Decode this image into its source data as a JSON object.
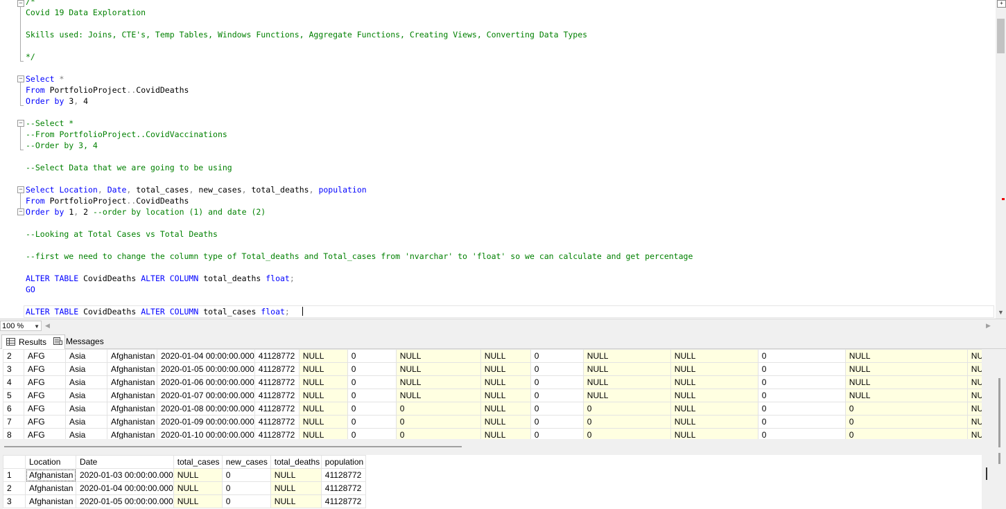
{
  "editor": {
    "lines": [
      {
        "parts": [
          {
            "t": "/*",
            "c": "cm"
          }
        ]
      },
      {
        "parts": [
          {
            "t": "Covid 19 Data Exploration",
            "c": "cm"
          }
        ]
      },
      {
        "parts": []
      },
      {
        "parts": [
          {
            "t": "Skills used: Joins, CTE's, Temp Tables, Windows Functions, Aggregate Functions, Creating Views, Converting Data Types",
            "c": "cm"
          }
        ]
      },
      {
        "parts": []
      },
      {
        "parts": [
          {
            "t": "*/",
            "c": "cm"
          }
        ]
      },
      {
        "parts": []
      },
      {
        "parts": [
          {
            "t": "Select",
            "c": "kw"
          },
          {
            "t": " *",
            "c": "gr"
          }
        ]
      },
      {
        "parts": [
          {
            "t": "From",
            "c": "kw"
          },
          {
            "t": " PortfolioProject",
            "c": ""
          },
          {
            "t": "..",
            "c": "gr"
          },
          {
            "t": "CovidDeaths",
            "c": ""
          }
        ]
      },
      {
        "parts": [
          {
            "t": "Order by",
            "c": "kw"
          },
          {
            "t": " 3",
            "c": ""
          },
          {
            "t": ",",
            "c": "gr"
          },
          {
            "t": " 4",
            "c": ""
          }
        ]
      },
      {
        "parts": []
      },
      {
        "parts": [
          {
            "t": "--Select *",
            "c": "cm"
          }
        ]
      },
      {
        "parts": [
          {
            "t": "--From PortfolioProject..CovidVaccinations",
            "c": "cm"
          }
        ]
      },
      {
        "parts": [
          {
            "t": "--Order by 3, 4",
            "c": "cm"
          }
        ]
      },
      {
        "parts": []
      },
      {
        "parts": [
          {
            "t": "--Select Data that we are going to be using",
            "c": "cm"
          }
        ]
      },
      {
        "parts": []
      },
      {
        "parts": [
          {
            "t": "Select",
            "c": "kw"
          },
          {
            "t": " Location",
            "c": "kw"
          },
          {
            "t": ",",
            "c": "gr"
          },
          {
            "t": " Date",
            "c": "kw"
          },
          {
            "t": ",",
            "c": "gr"
          },
          {
            "t": " total_cases",
            "c": ""
          },
          {
            "t": ",",
            "c": "gr"
          },
          {
            "t": " new_cases",
            "c": ""
          },
          {
            "t": ",",
            "c": "gr"
          },
          {
            "t": " total_deaths",
            "c": ""
          },
          {
            "t": ",",
            "c": "gr"
          },
          {
            "t": " population",
            "c": "kw"
          }
        ]
      },
      {
        "parts": [
          {
            "t": "From",
            "c": "kw"
          },
          {
            "t": " PortfolioProject",
            "c": ""
          },
          {
            "t": "..",
            "c": "gr"
          },
          {
            "t": "CovidDeaths",
            "c": ""
          }
        ]
      },
      {
        "parts": [
          {
            "t": "Order by",
            "c": "kw"
          },
          {
            "t": " 1",
            "c": ""
          },
          {
            "t": ",",
            "c": "gr"
          },
          {
            "t": " 2",
            "c": ""
          },
          {
            "t": " --order by location (1) and date (2)",
            "c": "cm"
          }
        ]
      },
      {
        "parts": []
      },
      {
        "parts": [
          {
            "t": "--Looking at Total Cases vs Total Deaths",
            "c": "cm"
          }
        ]
      },
      {
        "parts": []
      },
      {
        "parts": [
          {
            "t": "--first we need to change the column type of Total_deaths and Total_cases from 'nvarchar' to 'float' so we can calculate and get percentage",
            "c": "cm"
          }
        ]
      },
      {
        "parts": []
      },
      {
        "parts": [
          {
            "t": "ALTER TABLE",
            "c": "kw"
          },
          {
            "t": " CovidDeaths ",
            "c": ""
          },
          {
            "t": "ALTER COLUMN",
            "c": "kw"
          },
          {
            "t": " total_deaths ",
            "c": ""
          },
          {
            "t": "float",
            "c": "kw"
          },
          {
            "t": ";",
            "c": "gr"
          }
        ]
      },
      {
        "parts": [
          {
            "t": "GO",
            "c": "kw"
          }
        ]
      },
      {
        "parts": []
      },
      {
        "parts": [
          {
            "t": "ALTER TABLE",
            "c": "kw"
          },
          {
            "t": " CovidDeaths ",
            "c": ""
          },
          {
            "t": "ALTER COLUMN",
            "c": "kw"
          },
          {
            "t": " total_cases ",
            "c": ""
          },
          {
            "t": "float",
            "c": "kw"
          },
          {
            "t": ";",
            "c": "gr"
          }
        ]
      }
    ]
  },
  "zoom": {
    "value": "100 %"
  },
  "tabs": {
    "results": "Results",
    "messages": "Messages"
  },
  "grid1": {
    "rows": [
      [
        "2",
        "AFG",
        "Asia",
        "Afghanistan",
        "2020-01-04 00:00:00.000",
        "41128772",
        "NULL",
        "0",
        "NULL",
        "NULL",
        "0",
        "NULL",
        "NULL",
        "0",
        "NULL",
        "NU"
      ],
      [
        "3",
        "AFG",
        "Asia",
        "Afghanistan",
        "2020-01-05 00:00:00.000",
        "41128772",
        "NULL",
        "0",
        "NULL",
        "NULL",
        "0",
        "NULL",
        "NULL",
        "0",
        "NULL",
        "NU"
      ],
      [
        "4",
        "AFG",
        "Asia",
        "Afghanistan",
        "2020-01-06 00:00:00.000",
        "41128772",
        "NULL",
        "0",
        "NULL",
        "NULL",
        "0",
        "NULL",
        "NULL",
        "0",
        "NULL",
        "NU"
      ],
      [
        "5",
        "AFG",
        "Asia",
        "Afghanistan",
        "2020-01-07 00:00:00.000",
        "41128772",
        "NULL",
        "0",
        "NULL",
        "NULL",
        "0",
        "NULL",
        "NULL",
        "0",
        "NULL",
        "NU"
      ],
      [
        "6",
        "AFG",
        "Asia",
        "Afghanistan",
        "2020-01-08 00:00:00.000",
        "41128772",
        "NULL",
        "0",
        "0",
        "NULL",
        "0",
        "0",
        "NULL",
        "0",
        "0",
        "NU"
      ],
      [
        "7",
        "AFG",
        "Asia",
        "Afghanistan",
        "2020-01-09 00:00:00.000",
        "41128772",
        "NULL",
        "0",
        "0",
        "NULL",
        "0",
        "0",
        "NULL",
        "0",
        "0",
        "NU"
      ],
      [
        "8",
        "AFG",
        "Asia",
        "Afghanistan",
        "2020-01-10 00:00:00.000",
        "41128772",
        "NULL",
        "0",
        "0",
        "NULL",
        "0",
        "0",
        "NULL",
        "0",
        "0",
        "NU"
      ]
    ]
  },
  "grid2": {
    "headers": [
      "",
      "Location",
      "Date",
      "total_cases",
      "new_cases",
      "total_deaths",
      "population"
    ],
    "rows": [
      [
        "1",
        "Afghanistan",
        "2020-01-03 00:00:00.000",
        "NULL",
        "0",
        "NULL",
        "41128772"
      ],
      [
        "2",
        "Afghanistan",
        "2020-01-04 00:00:00.000",
        "NULL",
        "0",
        "NULL",
        "41128772"
      ],
      [
        "3",
        "Afghanistan",
        "2020-01-05 00:00:00.000",
        "NULL",
        "0",
        "NULL",
        "41128772"
      ]
    ]
  }
}
